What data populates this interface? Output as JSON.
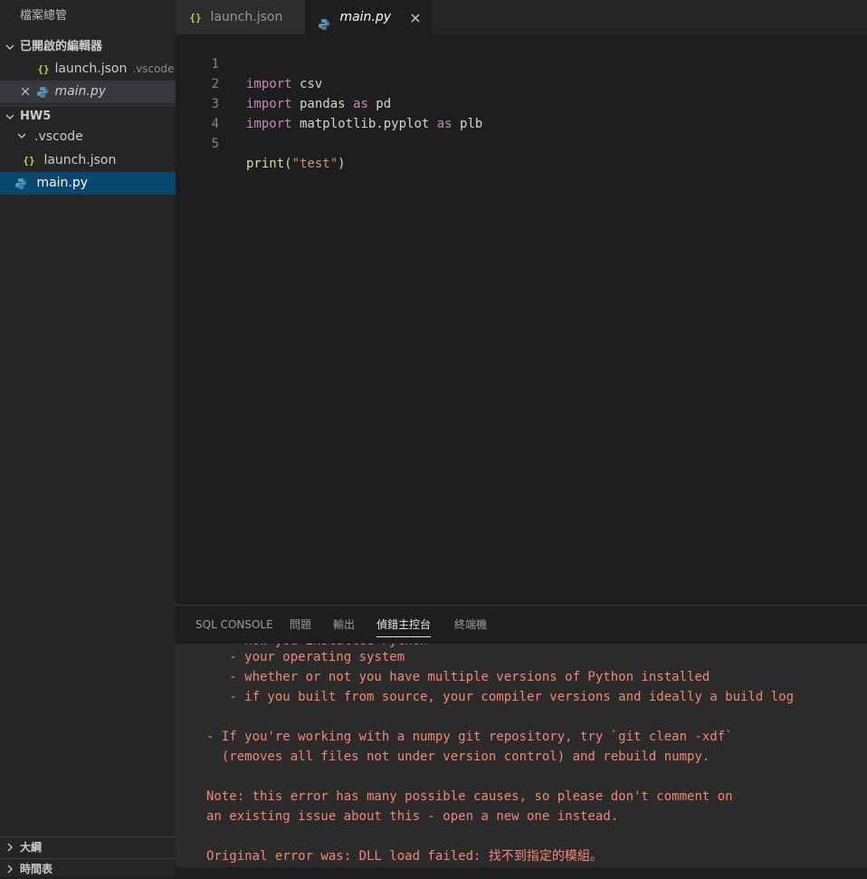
{
  "sidebar": {
    "title": "檔案總管",
    "open_editors": {
      "header": "已開啟的編輯器",
      "items": [
        {
          "name": "launch.json",
          "desc": ".vscode"
        },
        {
          "name": "main.py"
        }
      ]
    },
    "workspace": {
      "header": "HW5",
      "folder": ".vscode",
      "folder_file": "launch.json",
      "file": "main.py"
    },
    "outline": "大綱",
    "timeline": "時間表"
  },
  "tabs": [
    {
      "label": "launch.json"
    },
    {
      "label": "main.py"
    }
  ],
  "editor": {
    "line_numbers": [
      "1",
      "2",
      "3",
      "4",
      "5"
    ],
    "lines": [
      {
        "kw": "import",
        "rest": " csv"
      },
      {
        "kw": "import",
        "rest": " pandas ",
        "kw2": "as",
        "rest2": " pd"
      },
      {
        "kw": "import",
        "rest": " matplotlib.pyplot ",
        "kw2": "as",
        "rest2": " plb"
      },
      {},
      {
        "fn": "print",
        "open": "(",
        "str": "\"test\"",
        "close": ")"
      }
    ]
  },
  "panel": {
    "tabs": [
      "SQL CONSOLE",
      "問題",
      "輸出",
      "偵錯主控台",
      "終端機"
    ],
    "active_tab": "偵錯主控台",
    "console_lines": [
      "   - how you installed Python",
      "   - your operating system",
      "   - whether or not you have multiple versions of Python installed",
      "   - if you built from source, your compiler versions and ideally a build log",
      "",
      "- If you're working with a numpy git repository, try `git clean -xdf`",
      "  (removes all files not under version control) and rebuild numpy.",
      "",
      "Note: this error has many possible causes, so please don't comment on",
      "an existing issue about this - open a new one instead.",
      "",
      "Original error was: DLL load failed: 找不到指定的模組。"
    ]
  },
  "colors": {
    "error_text": "#f48771",
    "selection": "#094771",
    "keyword": "#c586c0",
    "string": "#ce9178",
    "function": "#dcdcaa",
    "json_icon": "#cbcb41",
    "python_icon": "#519aba"
  },
  "icons": {
    "chevron_down": "chevron-down-icon",
    "chevron_right": "chevron-right-icon",
    "close": "close-icon",
    "json": "json-file-icon",
    "python": "python-file-icon"
  }
}
